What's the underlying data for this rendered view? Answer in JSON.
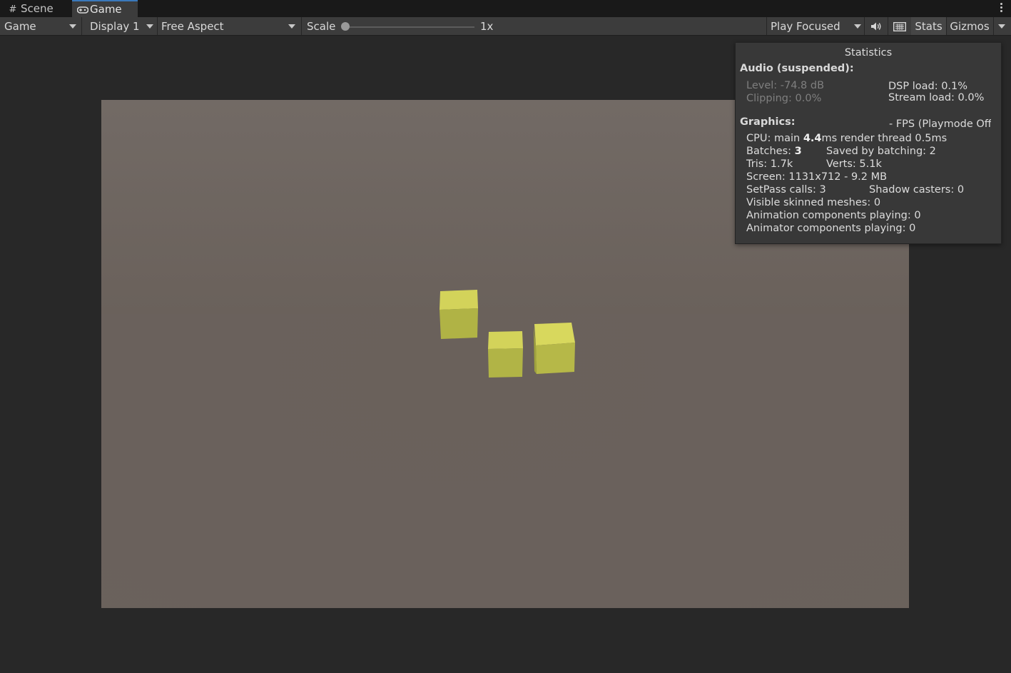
{
  "tabs": {
    "scene_label": "Scene",
    "game_label": "Game"
  },
  "toolbar": {
    "view_dropdown": "Game",
    "display_dropdown": "Display 1",
    "aspect_dropdown": "Free Aspect",
    "scale_label": "Scale",
    "scale_value": "1x",
    "scale_slider_fraction": 0,
    "play_mode_dropdown": "Play Focused",
    "stats_label": "Stats",
    "gizmos_label": "Gizmos"
  },
  "stats": {
    "title": "Statistics",
    "audio_heading": "Audio (suspended):",
    "audio_level": "Level: -74.8 dB",
    "audio_clipping": "Clipping: 0.0%",
    "dsp_load": "DSP load: 0.1%",
    "stream_load": "Stream load: 0.0%",
    "graphics_heading": "Graphics:",
    "fps": "- FPS (Playmode Off)",
    "cpu_prefix": "CPU: main ",
    "cpu_main_value": "4.4",
    "cpu_suffix": "ms  render thread 0.5ms",
    "batches_prefix": "Batches: ",
    "batches_value": "3",
    "saved_by_batching": "Saved by batching: 2",
    "tris": "Tris: 1.7k",
    "verts": "Verts: 5.1k",
    "screen": "Screen: 1131x712 - 9.2 MB",
    "setpass": "SetPass calls: 3",
    "shadow_casters": "Shadow casters: 0",
    "skinned_meshes": "Visible skinned meshes: 0",
    "animation_components": "Animation components playing: 0",
    "animator_components": "Animator components playing: 0"
  },
  "colors": {
    "cube_top": "#d3d35a",
    "cube_side": "#b2b446",
    "viewport_bg": "#6a615b",
    "panel_bg": "#383838",
    "toolbar_bg": "#3c3c3c"
  }
}
